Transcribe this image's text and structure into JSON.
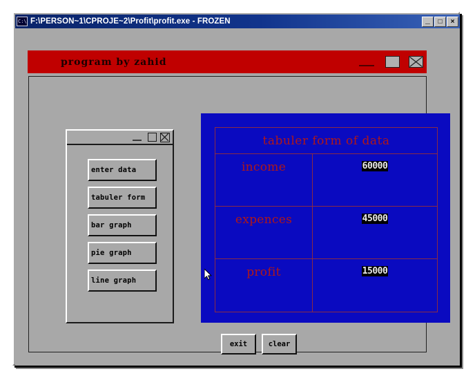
{
  "window": {
    "title": "F:\\PERSON~1\\CPROJE~2\\Profit\\profit.exe - FROZEN",
    "icon": "dos-console-icon",
    "controls": {
      "minimize": "_",
      "maximize": "□",
      "close": "×"
    }
  },
  "app_header": {
    "title": "program by zahid",
    "background_color": "#c00000",
    "text_color": "#1a0000",
    "controls": {
      "minimize": "minimize-icon",
      "maximize": "maximize-icon",
      "close": "close-icon"
    }
  },
  "menu_panel": {
    "controls": {
      "minimize": "minimize-icon",
      "maximize": "maximize-icon",
      "close": "close-icon"
    },
    "buttons": [
      {
        "label": "enter data"
      },
      {
        "label": "tabuler form"
      },
      {
        "label": "bar graph"
      },
      {
        "label": "pie graph"
      },
      {
        "label": "line graph"
      }
    ]
  },
  "table_panel": {
    "background_color": "#0a0ac0",
    "border_color": "#8b2b44",
    "label_color": "#b01818",
    "title": "tabuler form of data",
    "rows": [
      {
        "label": "income",
        "value": "60000"
      },
      {
        "label": "expences",
        "value": "45000"
      },
      {
        "label": "profit",
        "value": "15000"
      }
    ]
  },
  "actions": {
    "exit_label": "exit",
    "clear_label": "clear"
  }
}
